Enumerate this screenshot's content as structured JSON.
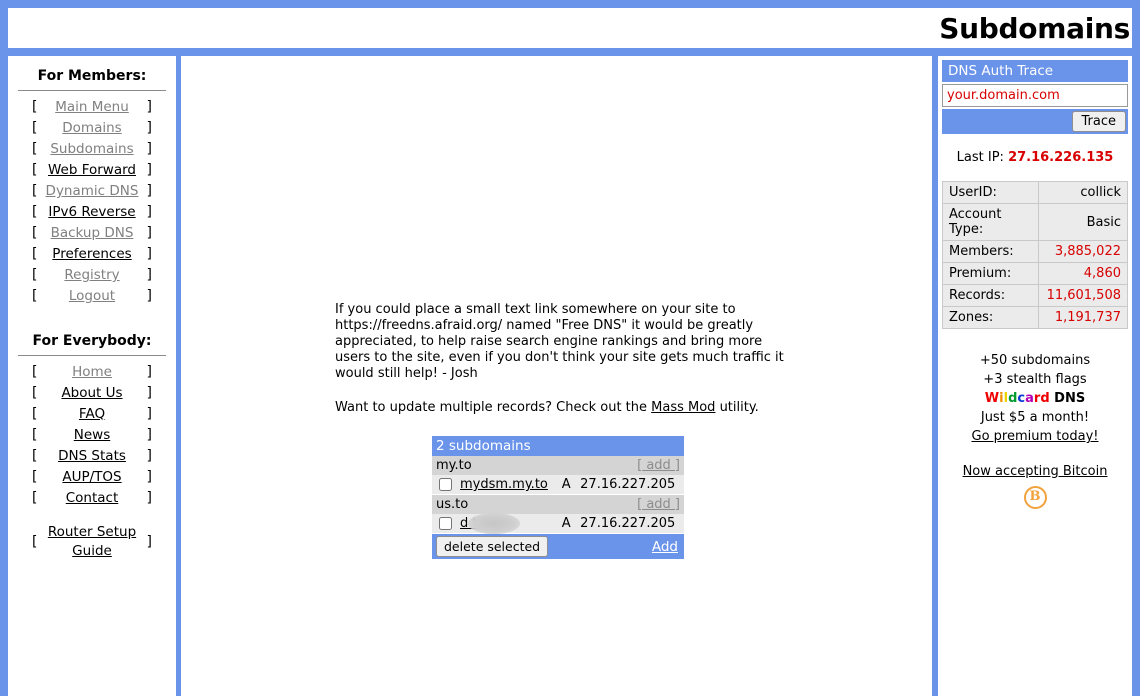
{
  "header": {
    "title": "Subdomains"
  },
  "sidebar": {
    "members_heading": "For Members:",
    "everybody_heading": "For Everybody:",
    "bracket_open": "[",
    "bracket_close": "]",
    "members_items": [
      {
        "label": "Main Menu",
        "state": "visited"
      },
      {
        "label": "Domains",
        "state": "visited"
      },
      {
        "label": "Subdomains",
        "state": "visited"
      },
      {
        "label": "Web Forward",
        "state": "fresh"
      },
      {
        "label": "Dynamic DNS",
        "state": "visited"
      },
      {
        "label": "IPv6 Reverse",
        "state": "fresh"
      },
      {
        "label": "Backup DNS",
        "state": "visited"
      },
      {
        "label": "Preferences",
        "state": "fresh"
      },
      {
        "label": "Registry",
        "state": "visited"
      },
      {
        "label": "Logout",
        "state": "visited"
      }
    ],
    "everybody_items": [
      {
        "label": "Home",
        "state": "visited"
      },
      {
        "label": "About Us",
        "state": "fresh"
      },
      {
        "label": "FAQ",
        "state": "fresh"
      },
      {
        "label": "News",
        "state": "fresh"
      },
      {
        "label": "DNS Stats",
        "state": "fresh"
      },
      {
        "label": "AUP/TOS",
        "state": "fresh"
      },
      {
        "label": "Contact",
        "state": "fresh"
      }
    ],
    "router_item": {
      "label": "Router Setup Guide",
      "state": "fresh"
    }
  },
  "main": {
    "notice": "If you could place a small text link somewhere on your site to https://freedns.afraid.org/ named \"Free DNS\" it would be greatly appreciated, to help raise search engine rankings and bring more users to the site, even if you don't think your site gets much traffic it would still help! - Josh",
    "massmod_prefix": "Want to update multiple records? Check out the ",
    "massmod_link": "Mass Mod",
    "massmod_suffix": " utility."
  },
  "subdomain_table": {
    "title": "2 subdomains",
    "add_label": "[ add ]",
    "groups": [
      {
        "domain": "my.to",
        "records": [
          {
            "name": "mydsm.my.to",
            "type": "A",
            "ip": "27.16.227.205",
            "checked": false,
            "redacted": false
          }
        ]
      },
      {
        "domain": "us.to",
        "records": [
          {
            "name": "d            to",
            "type": "A",
            "ip": "27.16.227.205",
            "checked": false,
            "redacted": true
          }
        ]
      }
    ],
    "delete_button": "delete selected",
    "add_link": "Add"
  },
  "right_panel": {
    "dns_auth_title": "DNS Auth Trace",
    "trace_input_value": "your.domain.com",
    "trace_button": "Trace",
    "last_ip_label": "Last IP: ",
    "last_ip_value": "27.16.226.135",
    "stats": [
      {
        "label": "UserID:",
        "value": "collick",
        "numeric": false
      },
      {
        "label": "Account Type:",
        "value": "Basic",
        "numeric": false
      },
      {
        "label": "Members:",
        "value": "3,885,022",
        "numeric": true
      },
      {
        "label": "Premium:",
        "value": "4,860",
        "numeric": true
      },
      {
        "label": "Records:",
        "value": "11,601,508",
        "numeric": true
      },
      {
        "label": "Zones:",
        "value": "1,191,737",
        "numeric": true
      }
    ],
    "promo": {
      "line1": "+50 subdomains",
      "line2": "+3 stealth flags",
      "wildcard_letters": [
        {
          "ch": "W",
          "color": "#ee0000"
        },
        {
          "ch": "i",
          "color": "#f09000"
        },
        {
          "ch": "l",
          "color": "#e8d400"
        },
        {
          "ch": "d",
          "color": "#009a2e"
        },
        {
          "ch": "c",
          "color": "#0a3ad6"
        },
        {
          "ch": "a",
          "color": "#b400b4"
        },
        {
          "ch": "r",
          "color": "#ee0000"
        },
        {
          "ch": "d",
          "color": "#ee0000"
        }
      ],
      "wildcard_suffix": " DNS",
      "line4": "Just $5 a month!",
      "premium_link": "Go premium today!",
      "bitcoin_link": "Now accepting Bitcoin",
      "bitcoin_glyph": "B"
    }
  }
}
